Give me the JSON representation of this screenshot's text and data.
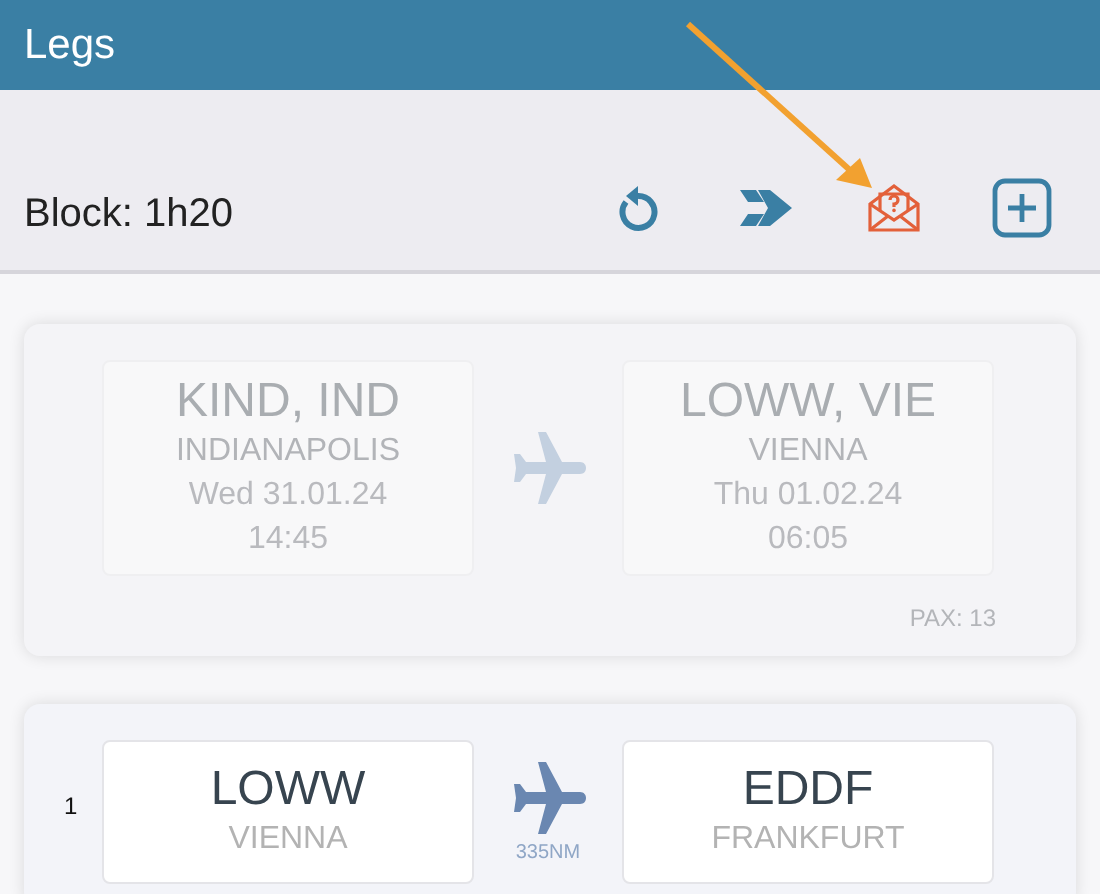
{
  "header": {
    "title": "Legs"
  },
  "toolbar": {
    "block": "Block: 1h20",
    "buttons": [
      {
        "kind": "undo"
      },
      {
        "kind": "route"
      },
      {
        "kind": "request"
      },
      {
        "kind": "add"
      }
    ]
  },
  "legs": [
    {
      "past": true,
      "from": {
        "code": "KIND, IND",
        "city": "INDIANAPOLIS",
        "date": "Wed 31.01.24",
        "time": "14:45"
      },
      "to": {
        "code": "LOWW, VIE",
        "city": "VIENNA",
        "date": "Thu 01.02.24",
        "time": "06:05"
      },
      "pax": "PAX: 13"
    },
    {
      "past": false,
      "number": "1",
      "from": {
        "code": "LOWW",
        "city": "VIENNA"
      },
      "to": {
        "code": "EDDF",
        "city": "FRANKFURT"
      },
      "distance": "335NM"
    }
  ]
}
